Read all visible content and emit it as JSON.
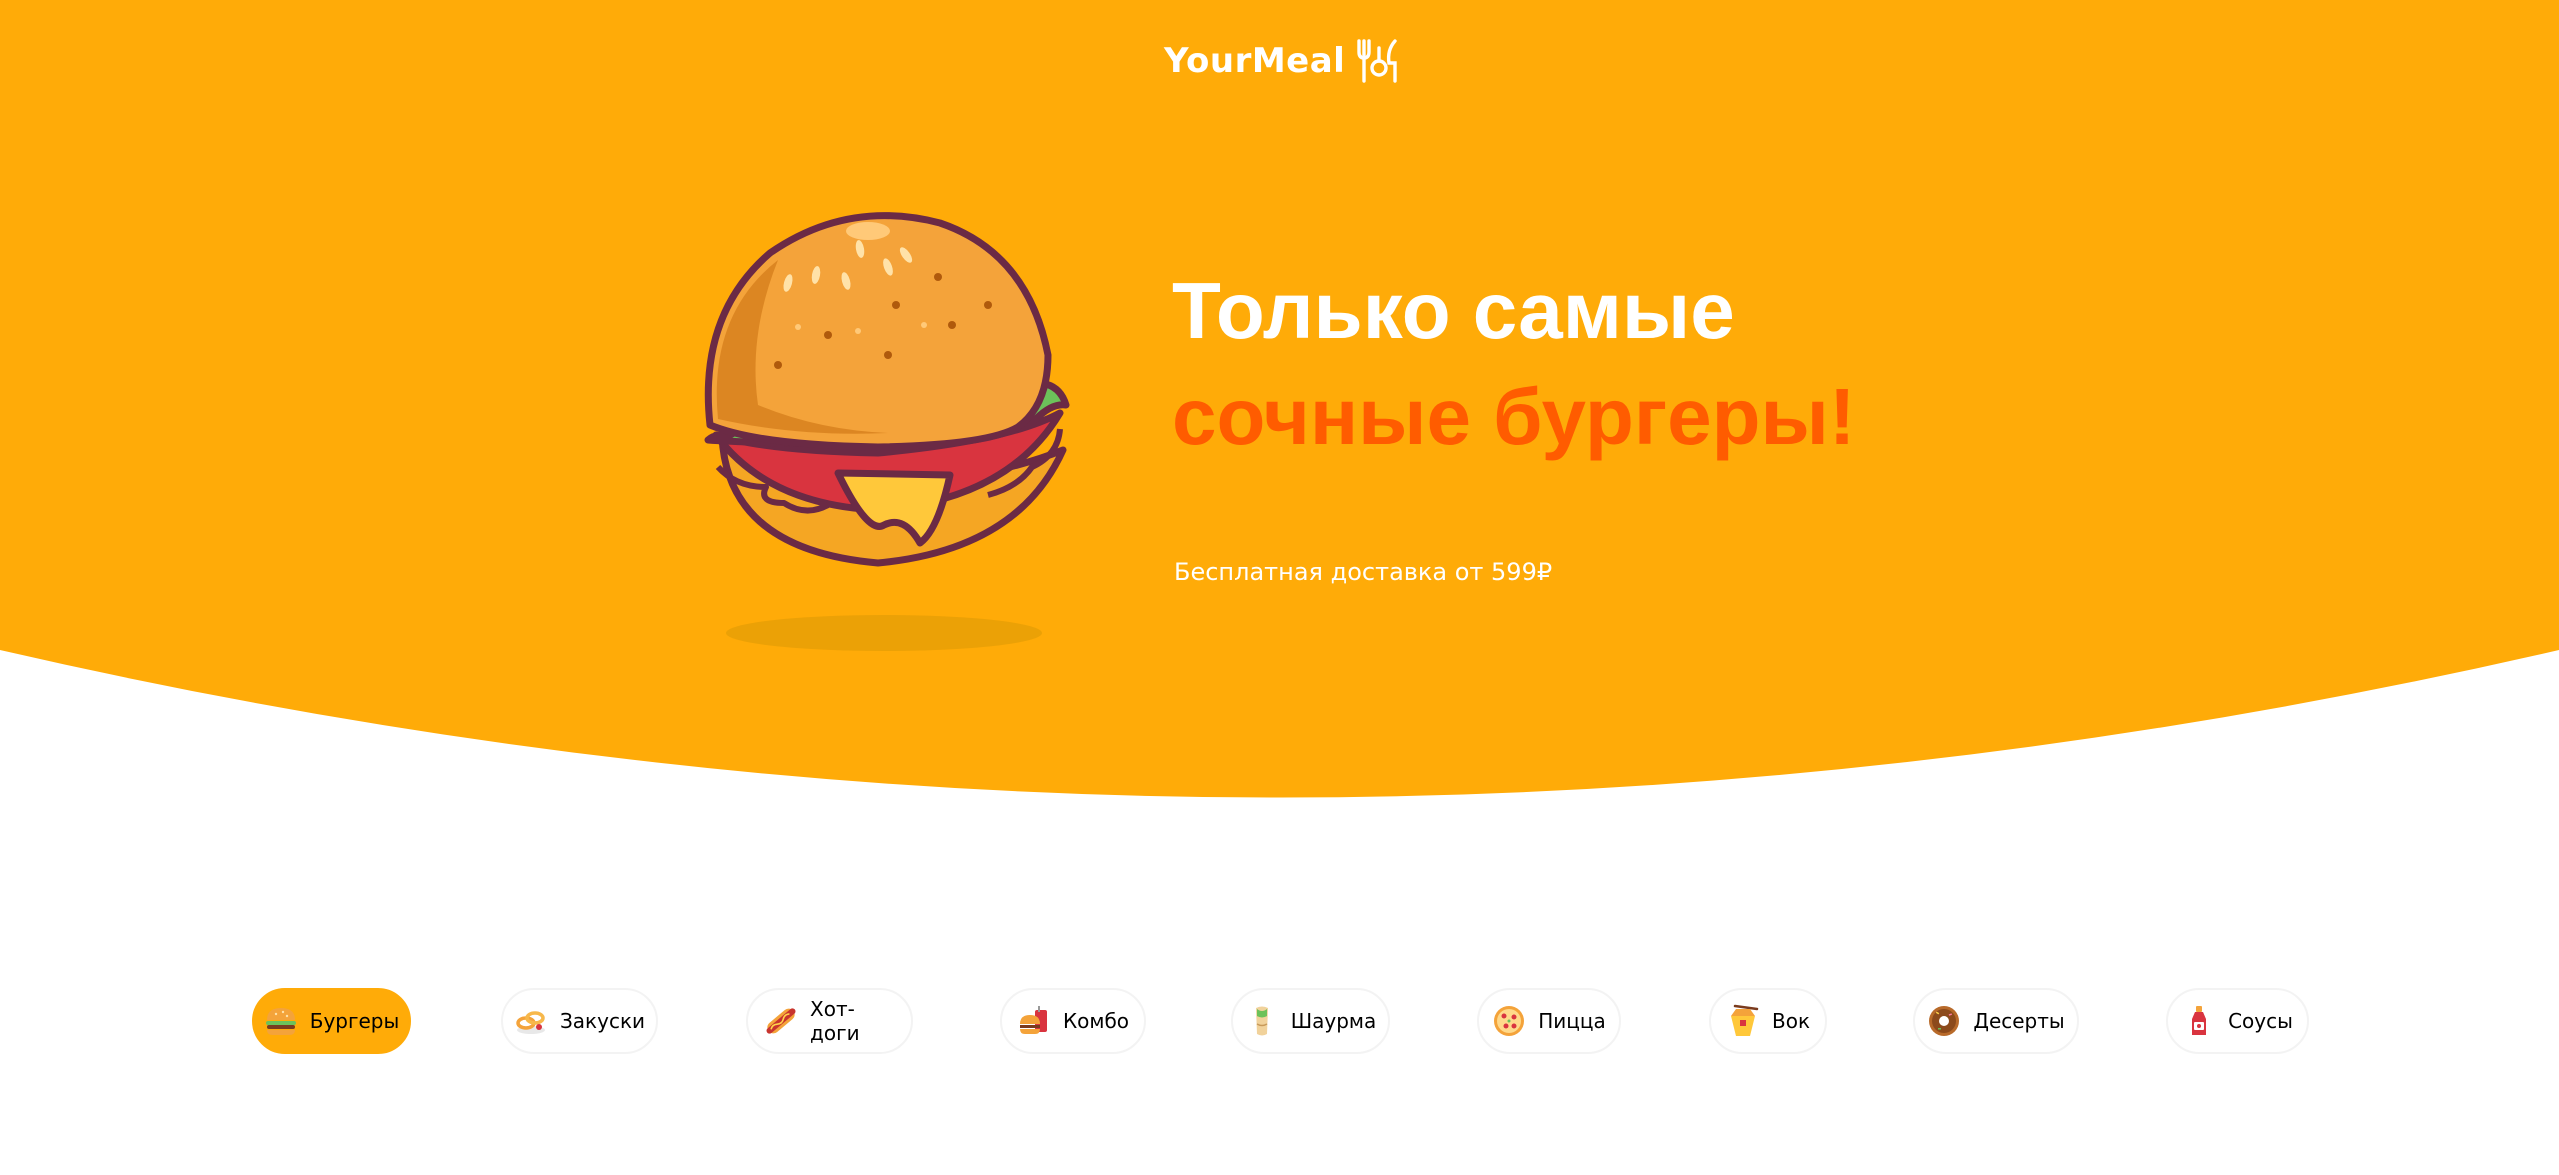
{
  "header": {
    "logo_text": "YourMeal",
    "logo_icon": "cutlery-icon"
  },
  "hero": {
    "title_line1": "Только самые",
    "title_line2": "сочные бургеры!",
    "subtitle": "Бесплатная доставка от 599₽",
    "image": "burger-illustration",
    "colors": {
      "background": "#ffab08",
      "title_primary": "#ffffff",
      "title_accent": "#ff5c00"
    }
  },
  "categories": {
    "active": "Бургеры",
    "active_color": "#ffab08",
    "items": [
      {
        "label": "Бургеры",
        "icon": "burger-icon"
      },
      {
        "label": "Закуски",
        "icon": "onion-rings-icon"
      },
      {
        "label": "Хот-доги",
        "icon": "hotdog-icon"
      },
      {
        "label": "Комбо",
        "icon": "combo-meal-icon"
      },
      {
        "label": "Шаурма",
        "icon": "shawarma-icon"
      },
      {
        "label": "Пицца",
        "icon": "pizza-icon"
      },
      {
        "label": "Вок",
        "icon": "wok-icon"
      },
      {
        "label": "Десерты",
        "icon": "donut-icon"
      },
      {
        "label": "Соусы",
        "icon": "sauce-bottle-icon"
      }
    ]
  }
}
